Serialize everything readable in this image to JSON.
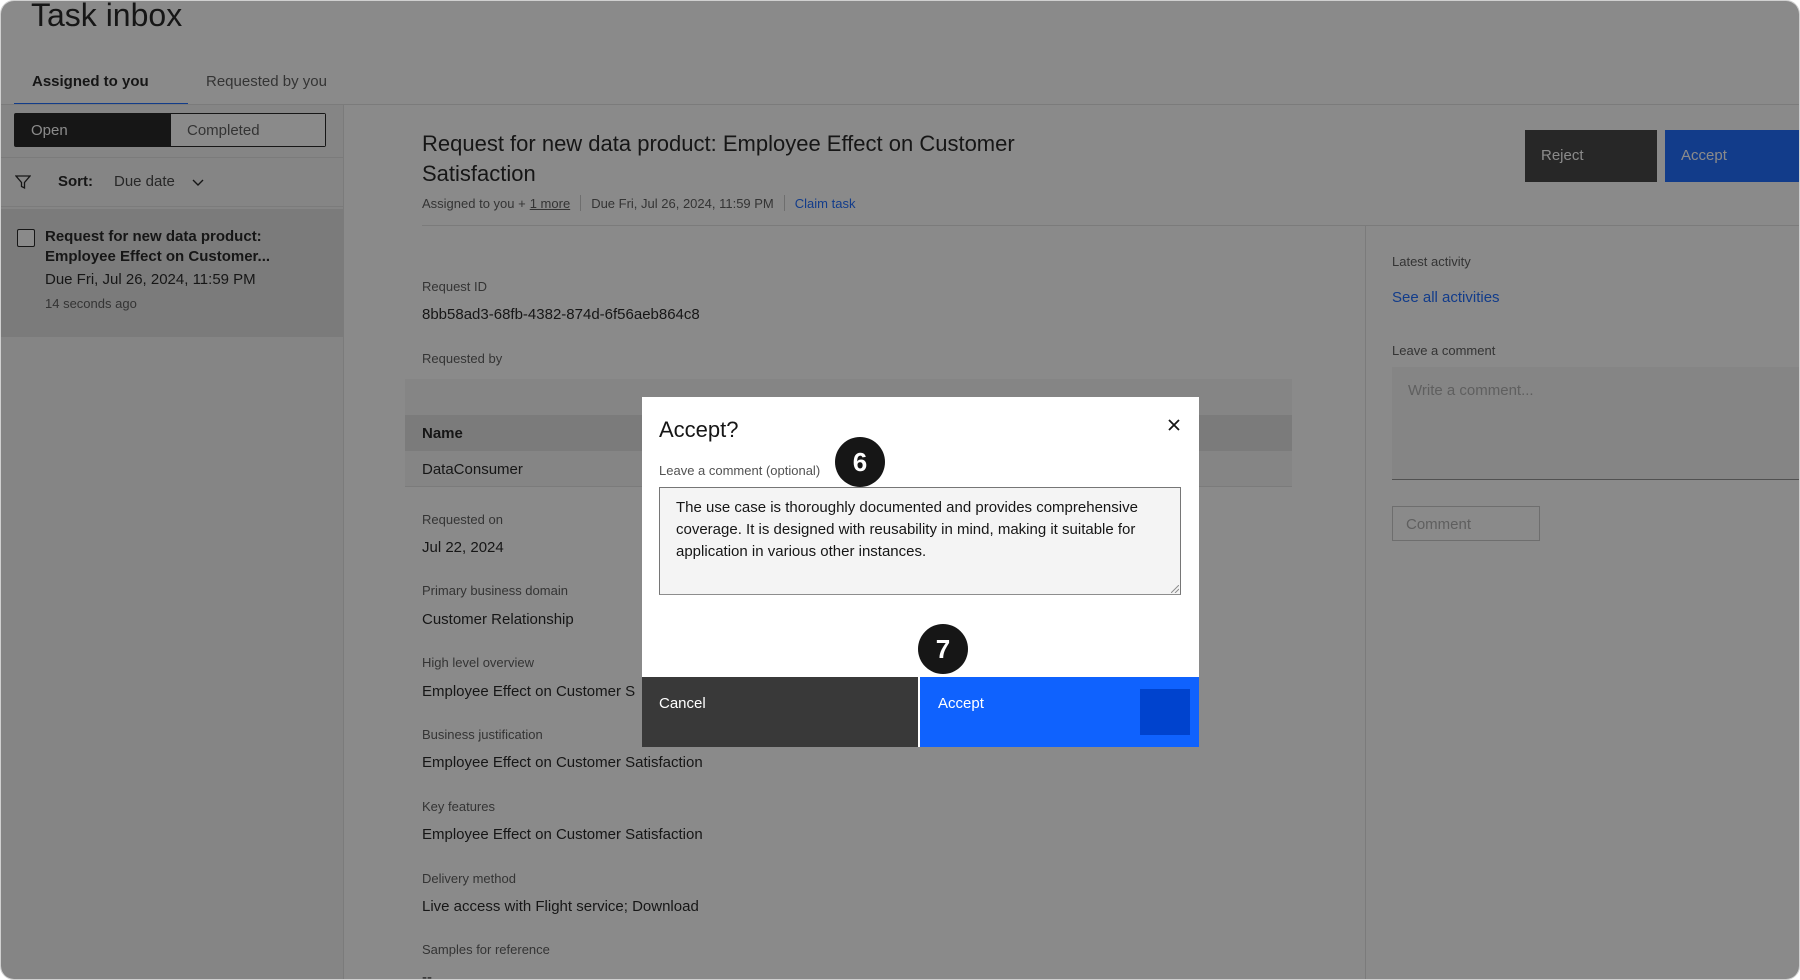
{
  "app": {
    "title": "Task inbox"
  },
  "tabs": [
    {
      "label": "Assigned to you",
      "active": true
    },
    {
      "label": "Requested by you",
      "active": false
    }
  ],
  "status_toggle": {
    "open": "Open",
    "completed": "Completed"
  },
  "sort": {
    "label": "Sort:",
    "value": "Due date"
  },
  "task_list": [
    {
      "title": "Request for new data product: Employee Effect on Customer...",
      "due": "Due Fri, Jul 26, 2024, 11:59 PM",
      "ago": "14 seconds ago"
    }
  ],
  "detail": {
    "title": "Request for new data product: Employee Effect on Customer Satisfaction",
    "assigned": "Assigned to you +",
    "more": "1 more",
    "due": "Due Fri, Jul 26, 2024, 11:59 PM",
    "claim": "Claim task",
    "reject_label": "Reject",
    "accept_label": "Accept",
    "fields": {
      "request_id_label": "Request ID",
      "request_id": "8bb58ad3-68fb-4382-874d-6f56aeb864c8",
      "requested_by_label": "Requested by",
      "table_header_name": "Name",
      "table_row_name": "DataConsumer",
      "requested_on_label": "Requested on",
      "requested_on": "Jul 22, 2024",
      "domain_label": "Primary business domain",
      "domain": "Customer Relationship",
      "overview_label": "High level overview",
      "overview": "Employee Effect on Customer S",
      "justification_label": "Business justification",
      "justification": "Employee Effect on Customer Satisfaction",
      "features_label": "Key features",
      "features": "Employee Effect on Customer Satisfaction",
      "delivery_label": "Delivery method",
      "delivery": "Live access with Flight service; Download",
      "samples_label": "Samples for reference",
      "samples": "--"
    }
  },
  "activity": {
    "latest_label": "Latest activity",
    "see_all": "See all activities",
    "comment_label": "Leave a comment",
    "comment_placeholder": "Write a comment...",
    "comment_button": "Comment"
  },
  "modal": {
    "title": "Accept?",
    "comment_label": "Leave a comment (optional)",
    "comment_text": "The use case is thoroughly documented and provides comprehensive coverage. It is designed with reusability in mind, making it suitable for application in various other instances.",
    "cancel": "Cancel",
    "accept": "Accept"
  },
  "callouts": {
    "step_a": "6",
    "step_b": "7"
  },
  "colors": {
    "accent": "#0f62fe",
    "dark": "#161616",
    "secondary": "#393939"
  }
}
